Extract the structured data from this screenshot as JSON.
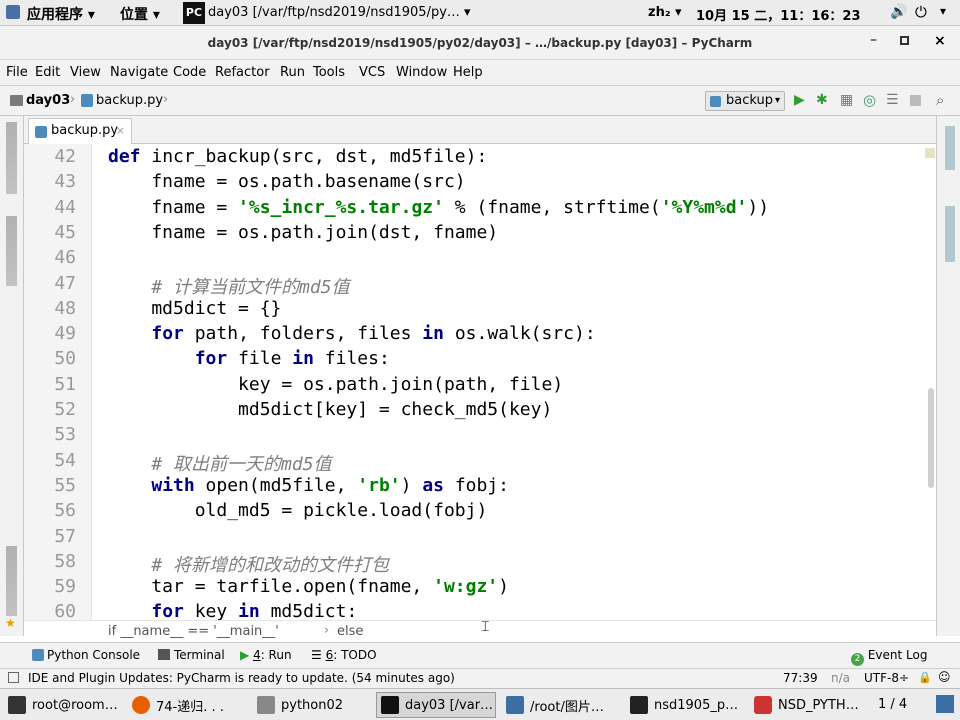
{
  "topbar": {
    "apps_menu": "应用程序",
    "places_menu": "位置",
    "active_window": "day03 [/var/ftp/nsd2019/nsd1905/py…",
    "input_method": "zh₂",
    "datetime": "10月 15 二，11：16：23"
  },
  "window": {
    "title": "day03 [/var/ftp/nsd2019/nsd1905/py02/day03] – …/backup.py [day03] – PyCharm"
  },
  "menu": [
    "File",
    "Edit",
    "View",
    "Navigate",
    "Code",
    "Refactor",
    "Run",
    "Tools",
    "VCS",
    "Window",
    "Help"
  ],
  "nav": {
    "crumbs": [
      "day03",
      "backup.py"
    ],
    "run_config": "backup"
  },
  "tab": {
    "label": "backup.py"
  },
  "editor": {
    "line_numbers": [
      "42",
      "43",
      "44",
      "45",
      "46",
      "47",
      "48",
      "49",
      "50",
      "51",
      "52",
      "53",
      "54",
      "55",
      "56",
      "57",
      "58",
      "59",
      "60"
    ],
    "lines": [
      [
        {
          "t": "def ",
          "c": "kw"
        },
        {
          "t": "incr_backup(src, dst, md5file):",
          "c": ""
        }
      ],
      [
        {
          "t": "    fname = os.path.basename(src)",
          "c": ""
        }
      ],
      [
        {
          "t": "    fname = ",
          "c": ""
        },
        {
          "t": "'%s_incr_%s.tar.gz'",
          "c": "st"
        },
        {
          "t": " % (fname, strftime(",
          "c": ""
        },
        {
          "t": "'%Y%m%d'",
          "c": "st"
        },
        {
          "t": "))",
          "c": ""
        }
      ],
      [
        {
          "t": "    fname = os.path.join(dst, fname)",
          "c": ""
        }
      ],
      [
        {
          "t": "",
          "c": ""
        }
      ],
      [
        {
          "t": "    ",
          "c": ""
        },
        {
          "t": "# 计算当前文件的md5值",
          "c": "cm"
        }
      ],
      [
        {
          "t": "    md5dict = {}",
          "c": ""
        }
      ],
      [
        {
          "t": "    ",
          "c": ""
        },
        {
          "t": "for ",
          "c": "kw"
        },
        {
          "t": "path, folders, files ",
          "c": ""
        },
        {
          "t": "in ",
          "c": "kw"
        },
        {
          "t": "os.walk(src):",
          "c": ""
        }
      ],
      [
        {
          "t": "        ",
          "c": ""
        },
        {
          "t": "for ",
          "c": "kw"
        },
        {
          "t": "file ",
          "c": ""
        },
        {
          "t": "in ",
          "c": "kw"
        },
        {
          "t": "files:",
          "c": ""
        }
      ],
      [
        {
          "t": "            key = os.path.join(path, file)",
          "c": ""
        }
      ],
      [
        {
          "t": "            md5dict[key] = check_md5(key)",
          "c": ""
        }
      ],
      [
        {
          "t": "",
          "c": ""
        }
      ],
      [
        {
          "t": "    ",
          "c": ""
        },
        {
          "t": "# 取出前一天的md5值",
          "c": "cm"
        }
      ],
      [
        {
          "t": "    ",
          "c": ""
        },
        {
          "t": "with ",
          "c": "kw"
        },
        {
          "t": "open(md5file, ",
          "c": ""
        },
        {
          "t": "'rb'",
          "c": "st"
        },
        {
          "t": ") ",
          "c": ""
        },
        {
          "t": "as ",
          "c": "kw"
        },
        {
          "t": "fobj:",
          "c": ""
        }
      ],
      [
        {
          "t": "        old_md5 = pickle.load(fobj)",
          "c": ""
        }
      ],
      [
        {
          "t": "",
          "c": ""
        }
      ],
      [
        {
          "t": "    ",
          "c": ""
        },
        {
          "t": "# 将新增的和改动的文件打包",
          "c": "cm"
        }
      ],
      [
        {
          "t": "    tar = tarfile.open(fname, ",
          "c": ""
        },
        {
          "t": "'w:gz'",
          "c": "st"
        },
        {
          "t": ")",
          "c": ""
        }
      ],
      [
        {
          "t": "    ",
          "c": ""
        },
        {
          "t": "for ",
          "c": "kw"
        },
        {
          "t": "key ",
          "c": ""
        },
        {
          "t": "in ",
          "c": "kw"
        },
        {
          "t": "md5dict:",
          "c": ""
        }
      ]
    ],
    "breadcrumb": [
      "if __name__ == '__main__'",
      "else"
    ]
  },
  "tool_windows": {
    "python_console": "Python Console",
    "terminal": "Terminal",
    "run_num": "4",
    "run": ": Run",
    "todo_num": "6",
    "todo": ": TODO",
    "event_log": "Event Log"
  },
  "status": {
    "message": "IDE and Plugin Updates: PyCharm is ready to update. (54 minutes ago)",
    "position": "77:39",
    "na": "n/a",
    "encoding": "UTF-8÷"
  },
  "taskbar": {
    "items": [
      "root@room…",
      "74-递归. . .",
      "python02",
      "day03 [/var…",
      "/root/图片…",
      "nsd1905_p…",
      "NSD_PYTH…"
    ],
    "pager": "1 / 4"
  },
  "colors": {
    "keyword": "#000080",
    "string": "#008000",
    "comment": "#808080",
    "line_number": "#999999"
  }
}
